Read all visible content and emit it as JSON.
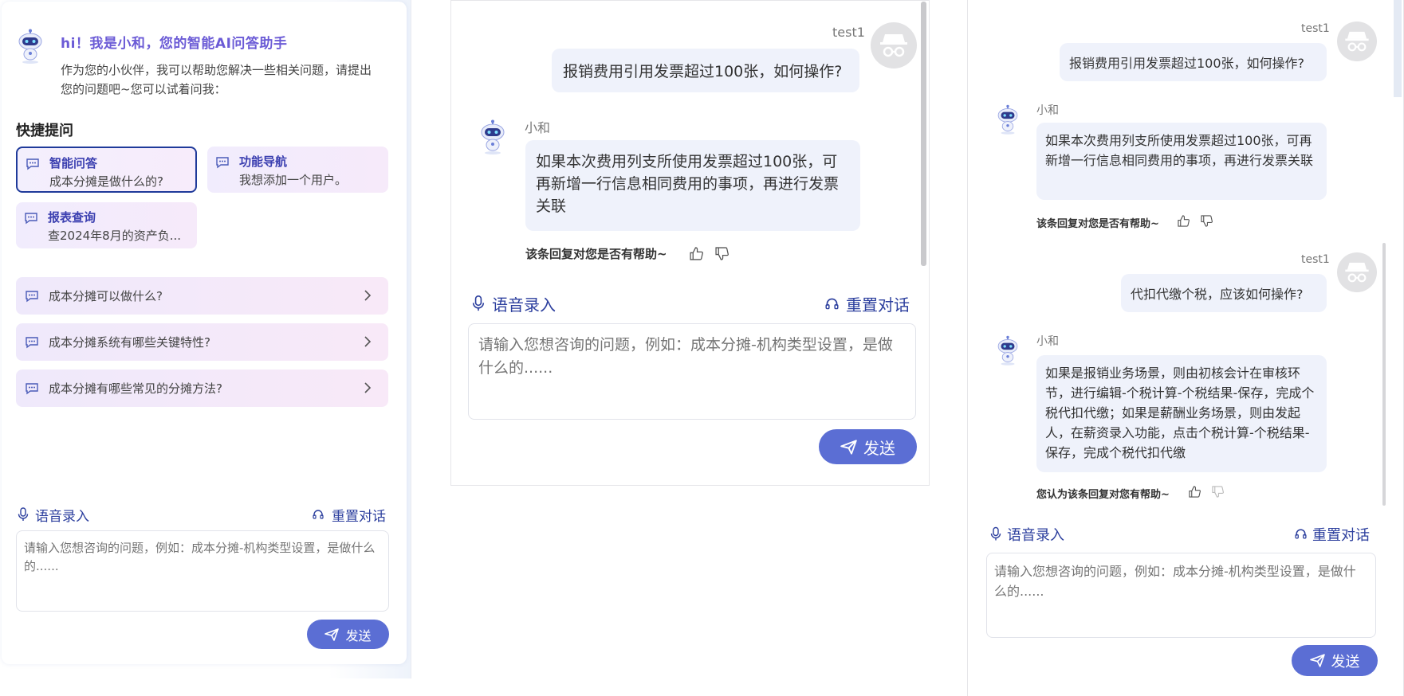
{
  "colors": {
    "accent": "#5b6ed4",
    "link_blue": "#2c3f9e",
    "greeting_purple": "#6b5bd6",
    "bubble_bg": "#eff2fb",
    "card_gradient_start": "#f1ecfd",
    "card_gradient_end": "#f6eafa"
  },
  "panel1": {
    "greeting_title": "hi！我是小和，您的智能AI问答助手",
    "greeting_desc": "作为您的小伙伴，我可以帮助您解决一些相关问题，请提出您的问题吧~您可以试着问我：",
    "quick_title": "快捷提问",
    "quick_cards": [
      {
        "title": "智能问答",
        "sub": "成本分摊是做什么的?",
        "icon": "chat-icon"
      },
      {
        "title": "功能导航",
        "sub": "我想添加一个用户。",
        "icon": "chat-icon"
      },
      {
        "title": "报表查询",
        "sub": "查2024年8月的资产负...",
        "icon": "chat-icon"
      }
    ],
    "suggestions": [
      {
        "text": "成本分摊可以做什么?"
      },
      {
        "text": "成本分摊系统有哪些关键特性?"
      },
      {
        "text": "成本分摊有哪些常见的分摊方法?"
      }
    ],
    "voice_label": "语音录入",
    "reset_label": "重置对话",
    "input_placeholder": "请输入您想咨询的问题，例如：成本分摊-机构类型设置，是做什么的......",
    "send_label": "发送"
  },
  "panel2": {
    "user_name": "test1",
    "user_message": "报销费用引用发票超过100张，如何操作?",
    "bot_name": "小和",
    "bot_message": "如果本次费用列支所使用发票超过100张，可再新增一行信息相同费用的事项，再进行发票关联",
    "helpful_text": "该条回复对您是否有帮助~",
    "voice_label": "语音录入",
    "reset_label": "重置对话",
    "input_placeholder": "请输入您想咨询的问题，例如：成本分摊-机构类型设置，是做什么的......",
    "send_label": "发送"
  },
  "panel3": {
    "messages": [
      {
        "role": "user",
        "name": "test1",
        "text": "报销费用引用发票超过100张，如何操作?"
      },
      {
        "role": "bot",
        "name": "小和",
        "text": "如果本次费用列支所使用发票超过100张，可再新增一行信息相同费用的事项，再进行发票关联",
        "helpful": "该条回复对您是否有帮助~"
      },
      {
        "role": "user",
        "name": "test1",
        "text": "代扣代缴个税，应该如何操作?"
      },
      {
        "role": "bot",
        "name": "小和",
        "text": "如果是报销业务场景，则由初核会计在审核环节，进行编辑-个税计算-个税结果-保存，完成个税代扣代缴；如果是薪酬业务场景，则由发起人，在薪资录入功能，点击个税计算-个税结果-保存，完成个税代扣代缴",
        "helpful": "您认为该条回复对您有帮助~"
      }
    ],
    "voice_label": "语音录入",
    "reset_label": "重置对话",
    "input_placeholder": "请输入您想咨询的问题，例如：成本分摊-机构类型设置，是做什么的......",
    "send_label": "发送"
  }
}
